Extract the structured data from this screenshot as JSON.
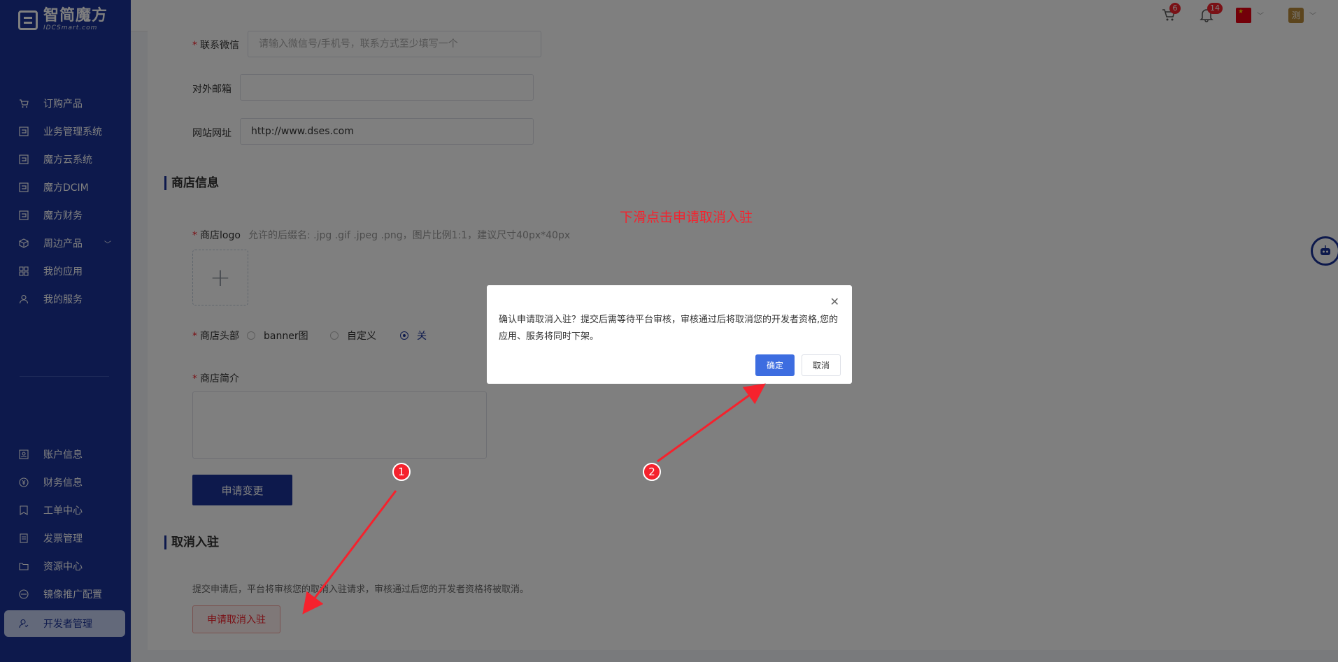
{
  "logo": {
    "cn": "智简魔方",
    "en": "IDCSmart.com"
  },
  "sidebar": {
    "items": [
      {
        "label": "订购产品"
      },
      {
        "label": "业务管理系统"
      },
      {
        "label": "魔方云系统"
      },
      {
        "label": "魔方DCIM"
      },
      {
        "label": "魔方财务"
      },
      {
        "label": "周边产品"
      },
      {
        "label": "我的应用"
      },
      {
        "label": "我的服务"
      }
    ],
    "bottom_items": [
      {
        "label": "账户信息"
      },
      {
        "label": "财务信息"
      },
      {
        "label": "工单中心"
      },
      {
        "label": "发票管理"
      },
      {
        "label": "资源中心"
      },
      {
        "label": "镜像推广配置"
      },
      {
        "label": "开发者管理"
      }
    ]
  },
  "header": {
    "cart_count": "6",
    "notification_count": "14",
    "avatar_text": "测"
  },
  "form": {
    "wechat_label": "联系微信",
    "wechat_placeholder": "请输入微信号/手机号，联系方式至少填写一个",
    "email_label": "对外邮箱",
    "email_value": "",
    "website_label": "网站网址",
    "website_value": "http://www.dses.com"
  },
  "shop": {
    "section_title": "商店信息",
    "logo_label": "商店logo",
    "logo_hint": "允许的后缀名: .jpg .gif .jpeg .png，图片比例1:1，建议尺寸40px*40px",
    "header_label": "商店头部",
    "header_options": [
      "banner图",
      "自定义",
      "关"
    ],
    "header_selected": "关",
    "intro_label": "商店简介",
    "apply_change_button": "申请变更"
  },
  "cancel_section": {
    "title": "取消入驻",
    "description": "提交申请后，平台将审核您的取消入驻请求，审核通过后您的开发者资格将被取消。",
    "button": "申请取消入驻"
  },
  "modal": {
    "message": "确认申请取消入驻？提交后需等待平台审核，审核通过后将取消您的开发者资格,您的应用、服务将同时下架。",
    "confirm": "确定",
    "cancel": "取消"
  },
  "annotations": {
    "note": "下滑点击申请取消入驻",
    "step1": "1",
    "step2": "2",
    "color": "#f5222d"
  }
}
